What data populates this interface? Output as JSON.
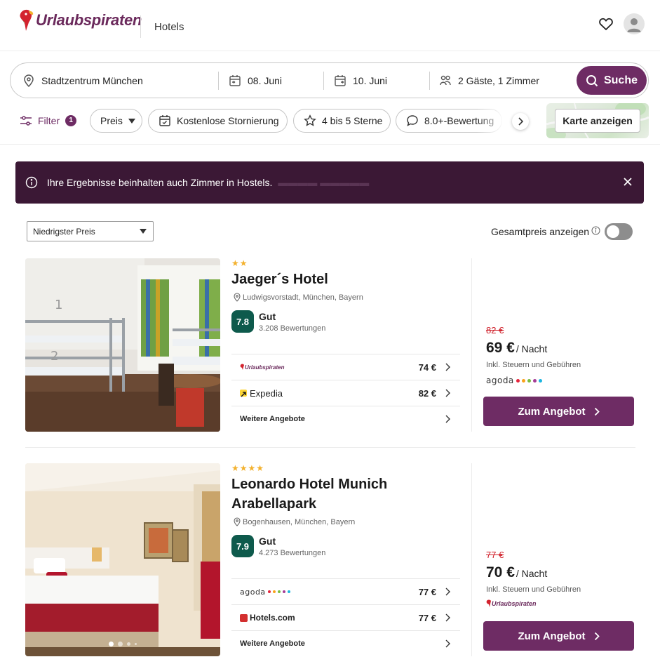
{
  "header": {
    "brand": "Urlaubspiraten",
    "nav_item": "Hotels"
  },
  "search": {
    "destination": "Stadtzentrum München",
    "checkin": "08. Juni",
    "checkout": "10. Juni",
    "guests": "2 Gäste, 1 Zimmer",
    "button_label": "Suche"
  },
  "filters": {
    "filter_label": "Filter",
    "filter_count": "1",
    "chips": [
      "Preis",
      "Kostenlose Stornierung",
      "4 bis 5 Sterne",
      "8.0+-Bewertung"
    ],
    "map_button": "Karte anzeigen"
  },
  "banner": {
    "text": "Ihre Ergebnisse beinhalten auch Zimmer in Hostels."
  },
  "sort": {
    "selected": "Niedrigster Preis",
    "total_price_label": "Gesamtpreis anzeigen",
    "total_price_enabled": false
  },
  "hotels": [
    {
      "stars": 2,
      "name": "Jaeger´s Hotel",
      "location": "Ludwigsvorstadt, München, Bayern",
      "score": "7.8",
      "rating_word": "Gut",
      "reviews": "3.208 Bewertungen",
      "offers": [
        {
          "provider": "Urlaubspiraten",
          "price": "74 €"
        },
        {
          "provider": "Expedia",
          "price": "82 €"
        }
      ],
      "more_offers": "Weitere Angebote",
      "old_price": "82 €",
      "price": "69 €",
      "per_night": "/ Nacht",
      "tax_note": "Inkl. Steuern und Gebühren",
      "best_provider": "agoda",
      "cta": "Zum Angebot"
    },
    {
      "stars": 4,
      "name": "Leonardo Hotel Munich Arabellapark",
      "location": "Bogenhausen, München, Bayern",
      "score": "7.9",
      "rating_word": "Gut",
      "reviews": "4.273 Bewertungen",
      "offers": [
        {
          "provider": "agoda",
          "price": "77 €"
        },
        {
          "provider": "Hotels.com",
          "price": "77 €"
        }
      ],
      "more_offers": "Weitere Angebote",
      "old_price": "77 €",
      "price": "70 €",
      "per_night": "/ Nacht",
      "tax_note": "Inkl. Steuern und Gebühren",
      "best_provider": "Urlaubspiraten",
      "cta": "Zum Angebot"
    }
  ],
  "colors": {
    "brand": "#6e2c64",
    "banner_bg": "#3b1835",
    "score_bg": "#0e5a4c",
    "strike_price": "#d0212b",
    "stars": "#f3b12d"
  }
}
